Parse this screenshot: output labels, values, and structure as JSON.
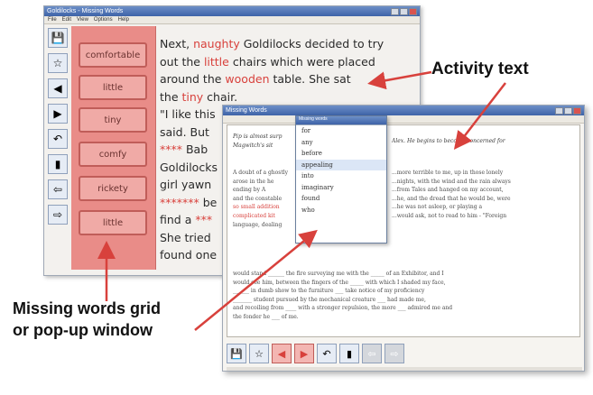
{
  "window1": {
    "title": "Goldilocks - Missing Words",
    "menu": [
      "File",
      "Edit",
      "View",
      "Options",
      "Help"
    ],
    "word_cards": [
      "comfortable",
      "little",
      "tiny",
      "comfy",
      "rickety",
      "little"
    ],
    "text_lines": [
      [
        {
          "t": "Next, ",
          "r": false
        },
        {
          "t": "naughty",
          "r": true
        },
        {
          "t": " Goldilocks decided to try",
          "r": false
        }
      ],
      [
        {
          "t": "out the ",
          "r": false
        },
        {
          "t": "little",
          "r": true
        },
        {
          "t": " chairs which were placed",
          "r": false
        }
      ],
      [
        {
          "t": "around the ",
          "r": false
        },
        {
          "t": "wooden",
          "r": true
        },
        {
          "t": " table. She sat",
          "r": false
        }
      ],
      [
        {
          "t": "the ",
          "r": false
        },
        {
          "t": "tiny",
          "r": true
        },
        {
          "t": " chair.",
          "r": false
        }
      ],
      [
        {
          "t": "\"I like this",
          "r": false
        }
      ],
      [
        {
          "t": "said. But",
          "r": false
        }
      ],
      [
        {
          "t": "****",
          "r": true
        },
        {
          "t": " Bab",
          "r": false
        }
      ],
      [
        {
          "t": "Goldilocks",
          "r": false
        }
      ],
      [
        {
          "t": "girl yawn",
          "r": false
        }
      ],
      [
        {
          "t": "*******",
          "r": true
        },
        {
          "t": " be",
          "r": false
        }
      ],
      [
        {
          "t": "find a ",
          "r": false
        },
        {
          "t": "***",
          "r": true
        }
      ],
      [
        {
          "t": "She tried",
          "r": false
        }
      ],
      [
        {
          "t": "found one",
          "r": false
        }
      ]
    ]
  },
  "window2": {
    "title": "Missing Words",
    "italic_lines": [
      "Pip is almost surp",
      "Magwitch's sit"
    ],
    "italic_right": "Alex. He begins to become concerned for",
    "left_lines": [
      "A doubt of a ghostly",
      "arose in the he",
      "ending by A",
      "and the constable",
      "so small addition",
      "complicated kit",
      "language, dealing"
    ],
    "right_lines": [
      "...more terrible to me, up in those lonely",
      "...nights, with the wind and the rain always",
      "...from Tales and hanged on my account,",
      "...he, and the dread that he would be, were",
      "...he was not asleep, or playing a",
      "...would ask, not to read to him - \"Foreign"
    ],
    "bottom_lines": [
      "would stand ______ the fire surveying me with the _____ of an Exhibitor, and I",
      "would see him, between the fingers of the _____ with which I shaded my face,",
      "______ in dumb show to the furniture ___ take notice of my proficiency",
      "_______ student pursued by the mechanical creature ___ had made me,",
      "and recoiling from ____ with a stronger repulsion, the more ___ admired me and",
      "the fonder he ___ of me."
    ]
  },
  "popup": {
    "title": "Missing words",
    "items": [
      "for",
      "any",
      "before",
      "appealing",
      "into",
      "imaginary",
      "found",
      "who"
    ]
  },
  "callouts": {
    "activity_text": "Activity text",
    "missing_line1": "Missing words grid",
    "missing_line2": "or pop-up window"
  },
  "colors": {
    "panel_pink": "#e98c88",
    "card_pink": "#f0aaa6",
    "highlight_red": "#d8413c",
    "arrow_red": "#d8413c",
    "titlebar_blue": "#3e63a8"
  }
}
